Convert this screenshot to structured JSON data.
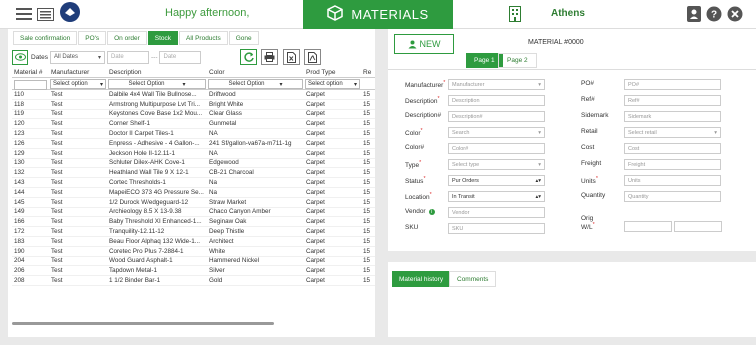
{
  "header": {
    "greeting": "Happy afternoon,",
    "module_title": "MATERIALS",
    "location": "Athens"
  },
  "list_tabs": [
    "Sale confirmation",
    "PO's",
    "On order",
    "Stock",
    "All Products",
    "Gone"
  ],
  "list_active_tab": "Stock",
  "filters": {
    "dates_label": "Dates",
    "dates_value": "All Dates",
    "date_from_placeholder": "Date",
    "date_separator": "---",
    "date_to_placeholder": "Date"
  },
  "grid": {
    "columns": [
      "Material #",
      "Manufacturer",
      "Description",
      "Color",
      "Prod Type",
      "Re"
    ],
    "select_option": "Select option",
    "select_option_cap": "Select Option",
    "rows": [
      [
        "110",
        "Test",
        "Dalbile 4x4 Wall Tile Bullnose...",
        "Driftwood",
        "Carpet",
        "15"
      ],
      [
        "118",
        "Test",
        "Armstrong Multipurpose Lvt Tri...",
        "Bright White",
        "Carpet",
        "15"
      ],
      [
        "119",
        "Test",
        "Keystones Cove Base 1x2 Mou...",
        "Clear Glass",
        "Carpet",
        "15"
      ],
      [
        "120",
        "Test",
        "Corner Shelf-1",
        "Gunmetal",
        "Carpet",
        "15"
      ],
      [
        "123",
        "Test",
        "Doctor II Carpet Tiles-1",
        "NA",
        "Carpet",
        "15"
      ],
      [
        "126",
        "Test",
        "Enpress - Adhesive - 4 Gallon-...",
        "241 Sf/gallon-va67a-m711-1g",
        "Carpet",
        "15"
      ],
      [
        "129",
        "Test",
        "Jeckson Hole II-12.11-1",
        "NA",
        "Carpet",
        "15"
      ],
      [
        "130",
        "Test",
        "Schluter Dilex-AHK Cove-1",
        "Edgewood",
        "Carpet",
        "15"
      ],
      [
        "132",
        "Test",
        "Heathland Wall Tile 9 X 12-1",
        "CB-21 Charcoal",
        "Carpet",
        "15"
      ],
      [
        "143",
        "Test",
        "Cortec Thresholds-1",
        "Na",
        "Carpet",
        "15"
      ],
      [
        "144",
        "Test",
        "MapeiECO 373 4G Pressure Se...",
        "Na",
        "Carpet",
        "15"
      ],
      [
        "145",
        "Test",
        "1/2 Durock W/edgeguard-12",
        "Straw Market",
        "Carpet",
        "15"
      ],
      [
        "149",
        "Test",
        "Archieology 8.5 X 13-9.38",
        "Chaco Canyon Amber",
        "Carpet",
        "15"
      ],
      [
        "166",
        "Test",
        "Baby Threshold XI Enhanced-1...",
        "Seginaw Oak",
        "Carpet",
        "15"
      ],
      [
        "172",
        "Test",
        "Tranquility-12.11-12",
        "Deep Thistle",
        "Carpet",
        "15"
      ],
      [
        "183",
        "Test",
        "Beau Floor Alphaq 132 Wide-1...",
        "Architect",
        "Carpet",
        "15"
      ],
      [
        "190",
        "Test",
        "Coretec Pro Plus 7-2884-1",
        "White",
        "Carpet",
        "15"
      ],
      [
        "204",
        "Test",
        "Wood Guard Asphalt-1",
        "Hammered Nickel",
        "Carpet",
        "15"
      ],
      [
        "206",
        "Test",
        "Tapdown Metal-1",
        "Silver",
        "Carpet",
        "15"
      ],
      [
        "208",
        "Test",
        "1 1/2 Binder Bar-1",
        "Gold",
        "Carpet",
        "15"
      ]
    ]
  },
  "detail": {
    "new_label": "NEW",
    "material_number": "MATERIAL #0000",
    "page_tabs": [
      "Page 1",
      "Page 2"
    ],
    "left_fields": [
      {
        "label": "Manufacturer",
        "req": "*",
        "value": "Manufacturer",
        "kind": "select"
      },
      {
        "label": "Description",
        "req": "*",
        "value": "Description",
        "kind": "text"
      },
      {
        "label": "Description#",
        "req": "",
        "value": "Description#",
        "kind": "text"
      },
      {
        "label": "Color",
        "req": "*",
        "value": "Search",
        "kind": "select"
      },
      {
        "label": "Color#",
        "req": "",
        "value": "Color#",
        "kind": "text"
      },
      {
        "label": "Type",
        "req": "*",
        "value": "Select type",
        "kind": "select"
      },
      {
        "label": "Status",
        "req": "*",
        "value": "Pur Orders",
        "kind": "select"
      },
      {
        "label": "Location",
        "req": "*",
        "value": "In Transit",
        "kind": "select"
      },
      {
        "label": "Vendor",
        "req": "",
        "value": "Vendor",
        "kind": "text"
      },
      {
        "label": "SKU",
        "req": "",
        "value": "SKU",
        "kind": "text"
      }
    ],
    "right_fields": [
      {
        "label": "PO#",
        "req": "",
        "value": "PO#",
        "kind": "text"
      },
      {
        "label": "Ref#",
        "req": "",
        "value": "Ref#",
        "kind": "text"
      },
      {
        "label": "Sidemark",
        "req": "",
        "value": "Sidemark",
        "kind": "text"
      },
      {
        "label": "Retail",
        "req": "",
        "value": "Select retail",
        "kind": "select"
      },
      {
        "label": "Cost",
        "req": "",
        "value": "Cost",
        "kind": "text"
      },
      {
        "label": "Freight",
        "req": "",
        "value": "Freight",
        "kind": "text"
      },
      {
        "label": "Units",
        "req": "*",
        "value": "Units",
        "kind": "text"
      },
      {
        "label": "Quantity",
        "req": "",
        "value": "Quantity",
        "kind": "text"
      }
    ],
    "orig_label": "Orig",
    "wkl_label": "W/L",
    "wkl_req": "*"
  },
  "bottom_tabs": [
    "Material history",
    "Comments"
  ],
  "colors": {
    "accent": "#2e9b3f"
  }
}
